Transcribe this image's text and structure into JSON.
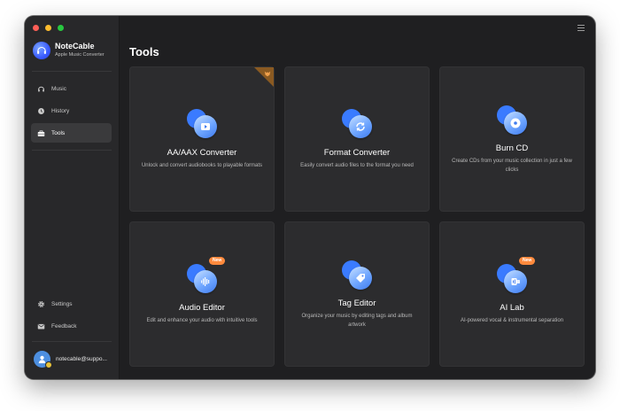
{
  "app": {
    "name": "NoteCable",
    "subtitle": "Apple Music Converter"
  },
  "sidebar": {
    "items": [
      {
        "label": "Music",
        "icon": "headphones-icon"
      },
      {
        "label": "History",
        "icon": "clock-icon"
      },
      {
        "label": "Tools",
        "icon": "toolbox-icon",
        "active": true
      }
    ],
    "bottom_items": [
      {
        "label": "Settings",
        "icon": "gear-icon"
      },
      {
        "label": "Feedback",
        "icon": "mail-icon"
      }
    ],
    "user_email": "notecable@suppo..."
  },
  "main": {
    "title": "Tools",
    "badge_label": "New",
    "tools": [
      {
        "title": "AA/AAX Converter",
        "desc": "Unlock and convert audiobooks to playable formats",
        "icon": "play-icon",
        "is_new": false,
        "corner": true
      },
      {
        "title": "Format Converter",
        "desc": "Easily convert audio files to the format you need",
        "icon": "refresh-icon",
        "is_new": false
      },
      {
        "title": "Burn CD",
        "desc": "Create CDs from your music collection in just a few clicks",
        "icon": "disc-icon",
        "is_new": false
      },
      {
        "title": "Audio Editor",
        "desc": "Edit and enhance your audio with intuitive tools",
        "icon": "waveform-icon",
        "is_new": true
      },
      {
        "title": "Tag Editor",
        "desc": "Organize your music by editing tags and album artwork",
        "icon": "tag-icon",
        "is_new": false
      },
      {
        "title": "AI Lab",
        "desc": "AI-powered vocal & instrumental separation",
        "icon": "ai-icon",
        "is_new": true
      }
    ]
  },
  "colors": {
    "accent": "#3a7bff",
    "badge": "#ff8a3d",
    "window_bg": "#1f1f21",
    "card_bg": "#2c2c2e"
  }
}
